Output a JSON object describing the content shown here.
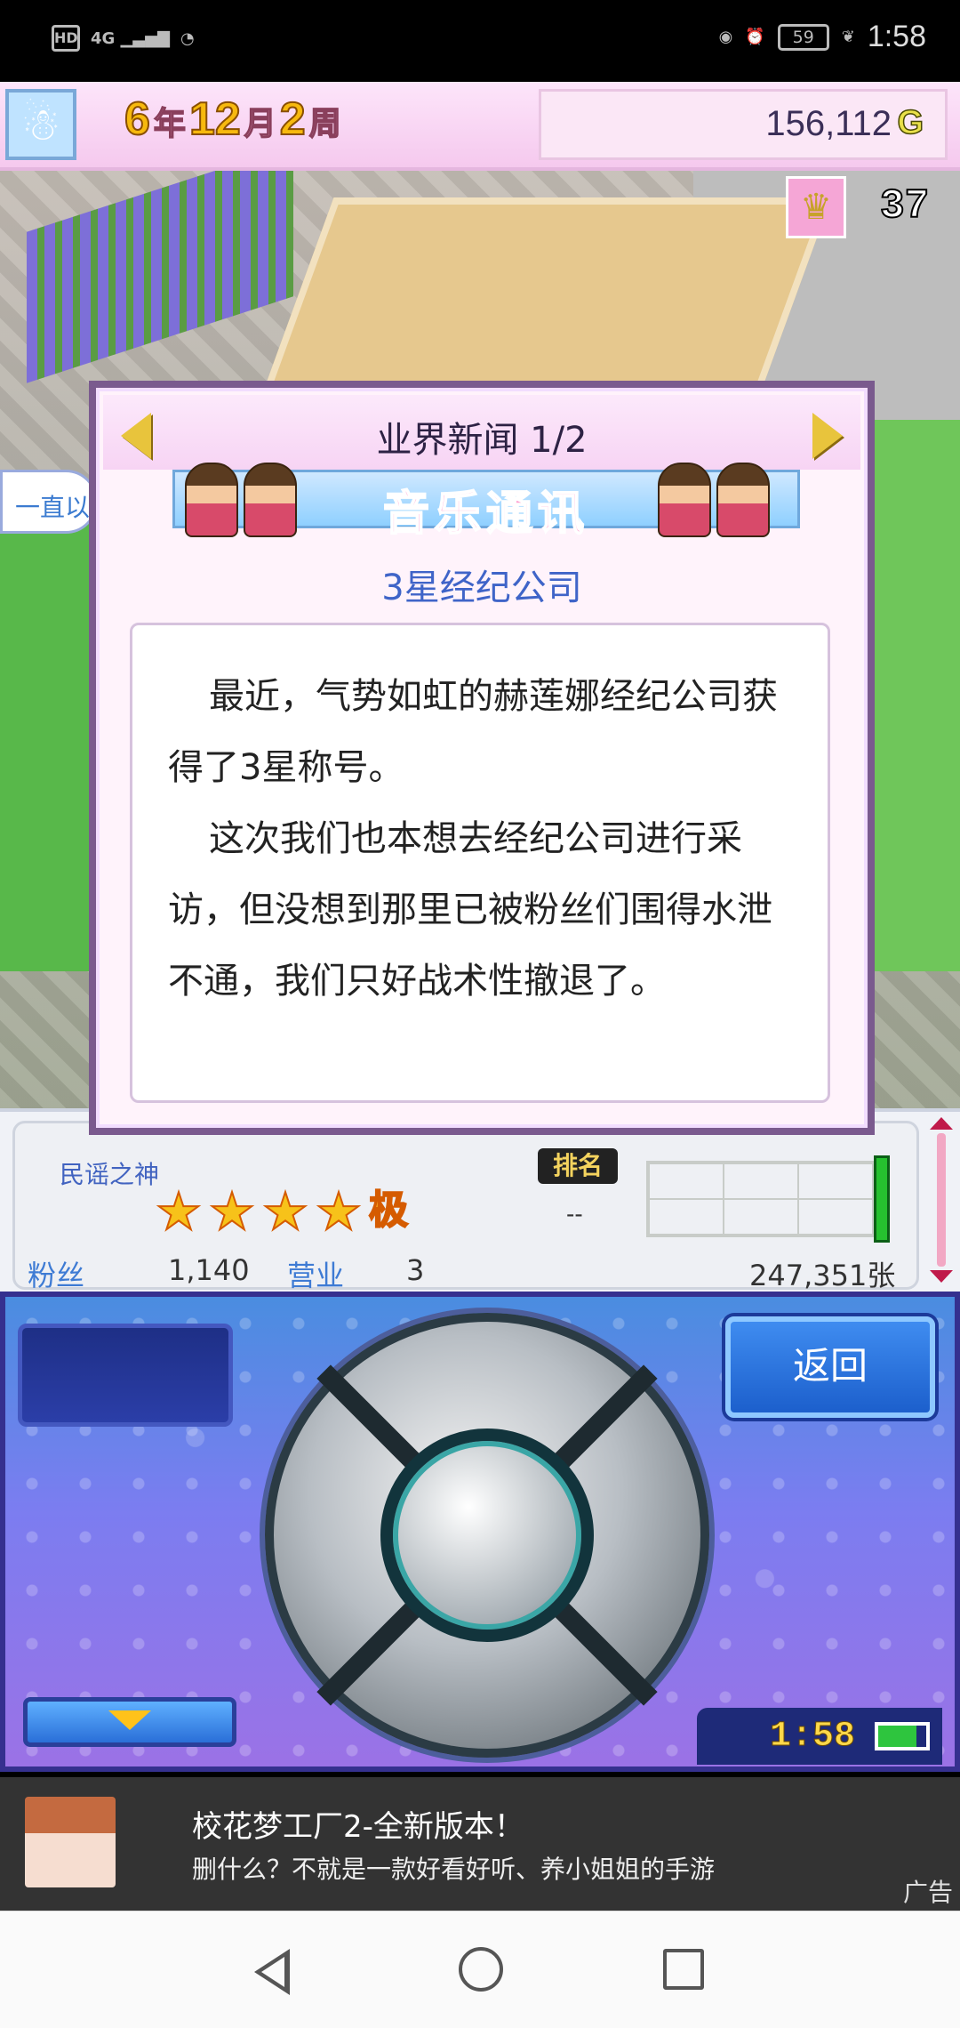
{
  "status_bar": {
    "hd": "HD",
    "network": "4G",
    "battery": "59",
    "time": "1:58"
  },
  "hud": {
    "year_num": "6",
    "year_unit": "年",
    "month_num": "12",
    "month_unit": "月",
    "week_num": "2",
    "week_unit": "周",
    "money": "156,112",
    "money_unit": "G",
    "trophy_count": "37",
    "side_chip": "一直以"
  },
  "dialog": {
    "title": "业界新闻 1/2",
    "banner": "音乐通讯",
    "subtitle": "3星经纪公司",
    "paragraphs": [
      "最近，气势如虹的赫莲娜经纪公司获得了3星称号。",
      "这次我们也本想去经纪公司进行采访，但没想到那里已被粉丝们围得水泄不通，我们只好战术性撤退了。"
    ]
  },
  "stats": {
    "genre": "民谣之神",
    "star_rating": 4,
    "rank_suffix": "极",
    "rank_label": "排名",
    "rank_value": "--",
    "fans_label": "粉丝",
    "fans_value": "1,140",
    "business_label": "营业",
    "business_value": "3",
    "sales_value": "247,351张"
  },
  "controller": {
    "back_label": "返回",
    "clock": "1:58"
  },
  "ad": {
    "title": "校花梦工厂2-全新版本！",
    "desc": "删什么？不就是一款好看好听、养小姐姐的手游",
    "tag": "广告"
  },
  "colors": {
    "accent_blue": "#3f64c8",
    "gold": "#f7b90e",
    "dialog_border": "#7a5a8e"
  }
}
